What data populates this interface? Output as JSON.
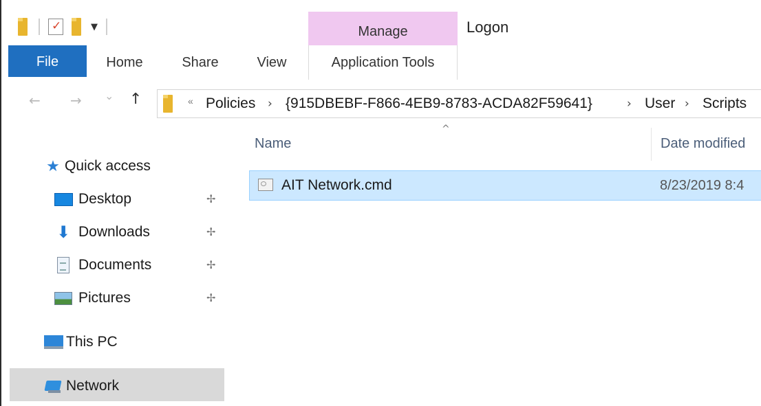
{
  "window": {
    "title": "Logon",
    "context_tab_group": "Manage",
    "context_color": "#f0c8f0"
  },
  "ribbon": {
    "tabs": [
      {
        "label": "File"
      },
      {
        "label": "Home"
      },
      {
        "label": "Share"
      },
      {
        "label": "View"
      },
      {
        "label": "Application Tools"
      }
    ],
    "file_color": "#1f6fc0"
  },
  "address_bar": {
    "overflow": "«",
    "crumbs": [
      "Policies",
      "{915DBEBF-F866-4EB9-8783-ACDA82F59641}",
      "User",
      "Scripts"
    ]
  },
  "nav_buttons": {
    "back": "←",
    "forward": "→",
    "recent": "⌄",
    "up": "↑"
  },
  "nav_pane": {
    "quick_access": "Quick access",
    "items": [
      {
        "label": "Desktop",
        "icon": "desktop-icon",
        "pinned": true
      },
      {
        "label": "Downloads",
        "icon": "downloads-icon",
        "pinned": true
      },
      {
        "label": "Documents",
        "icon": "documents-icon",
        "pinned": true
      },
      {
        "label": "Pictures",
        "icon": "pictures-icon",
        "pinned": true
      }
    ],
    "this_pc": "This PC",
    "network": "Network",
    "pin_glyph": "📌"
  },
  "file_list": {
    "columns": [
      "Name",
      "Date modified"
    ],
    "sort_indicator": "^",
    "rows": [
      {
        "name": "AIT Network.cmd",
        "date": "8/23/2019 8:4"
      }
    ],
    "selected_color": "#cce8ff"
  }
}
